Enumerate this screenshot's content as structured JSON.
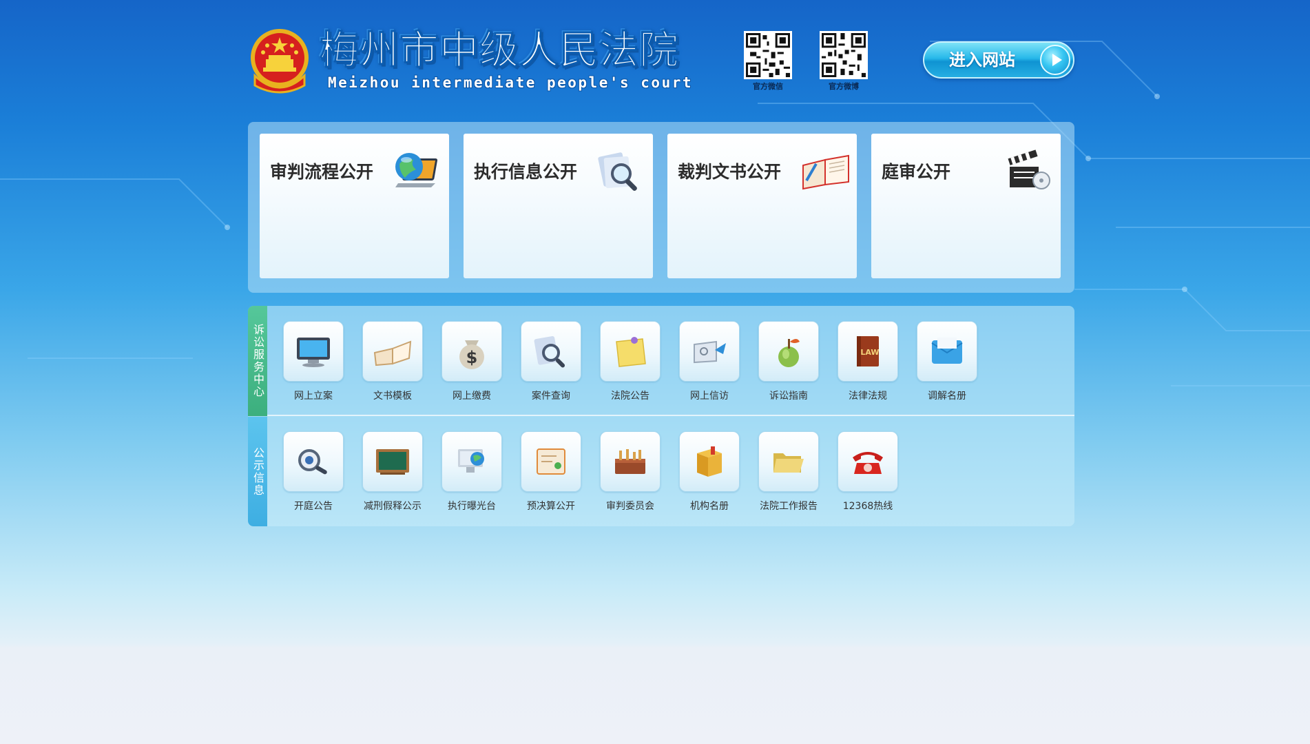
{
  "header": {
    "title_cn": "梅州市中级人民法院",
    "title_en": "Meizhou intermediate people's court",
    "qr_codes": [
      {
        "caption": "官方微信",
        "icon": "qr-code-icon"
      },
      {
        "caption": "官方微博",
        "icon": "qr-code-icon"
      }
    ],
    "enter_label": "进入网站"
  },
  "big_cards": [
    {
      "label": "审判流程公开",
      "icon": "globe-laptop-icon"
    },
    {
      "label": "执行信息公开",
      "icon": "magnifier-folder-icon"
    },
    {
      "label": "裁判文书公开",
      "icon": "open-book-icon"
    },
    {
      "label": "庭审公开",
      "icon": "clapperboard-icon"
    }
  ],
  "service_center": {
    "tab_label": "诉讼服务中心",
    "items": [
      {
        "label": "网上立案",
        "icon": "monitor-icon"
      },
      {
        "label": "文书模板",
        "icon": "book-icon"
      },
      {
        "label": "网上缴费",
        "icon": "money-bag-icon"
      },
      {
        "label": "案件查询",
        "icon": "search-icon"
      },
      {
        "label": "法院公告",
        "icon": "sticky-note-icon"
      },
      {
        "label": "网上信访",
        "icon": "mail-icon"
      },
      {
        "label": "诉讼指南",
        "icon": "apple-icon"
      },
      {
        "label": "法律法规",
        "icon": "law-book-icon"
      },
      {
        "label": "调解名册",
        "icon": "envelope-icon"
      }
    ]
  },
  "public_info": {
    "tab_label": "公示信息",
    "items": [
      {
        "label": "开庭公告",
        "icon": "magnifier-disc-icon"
      },
      {
        "label": "减刑假释公示",
        "icon": "blackboard-icon"
      },
      {
        "label": "执行曝光台",
        "icon": "globe-monitor-icon"
      },
      {
        "label": "预决算公开",
        "icon": "document-icon"
      },
      {
        "label": "审判委员会",
        "icon": "toolbox-icon"
      },
      {
        "label": "机构名册",
        "icon": "gift-box-icon"
      },
      {
        "label": "法院工作报告",
        "icon": "folder-icon"
      },
      {
        "label": "12368热线",
        "icon": "telephone-icon"
      }
    ]
  },
  "colors": {
    "accent_green": "#3caf7e",
    "accent_blue": "#3eaee2",
    "button": "#27b8ea"
  }
}
